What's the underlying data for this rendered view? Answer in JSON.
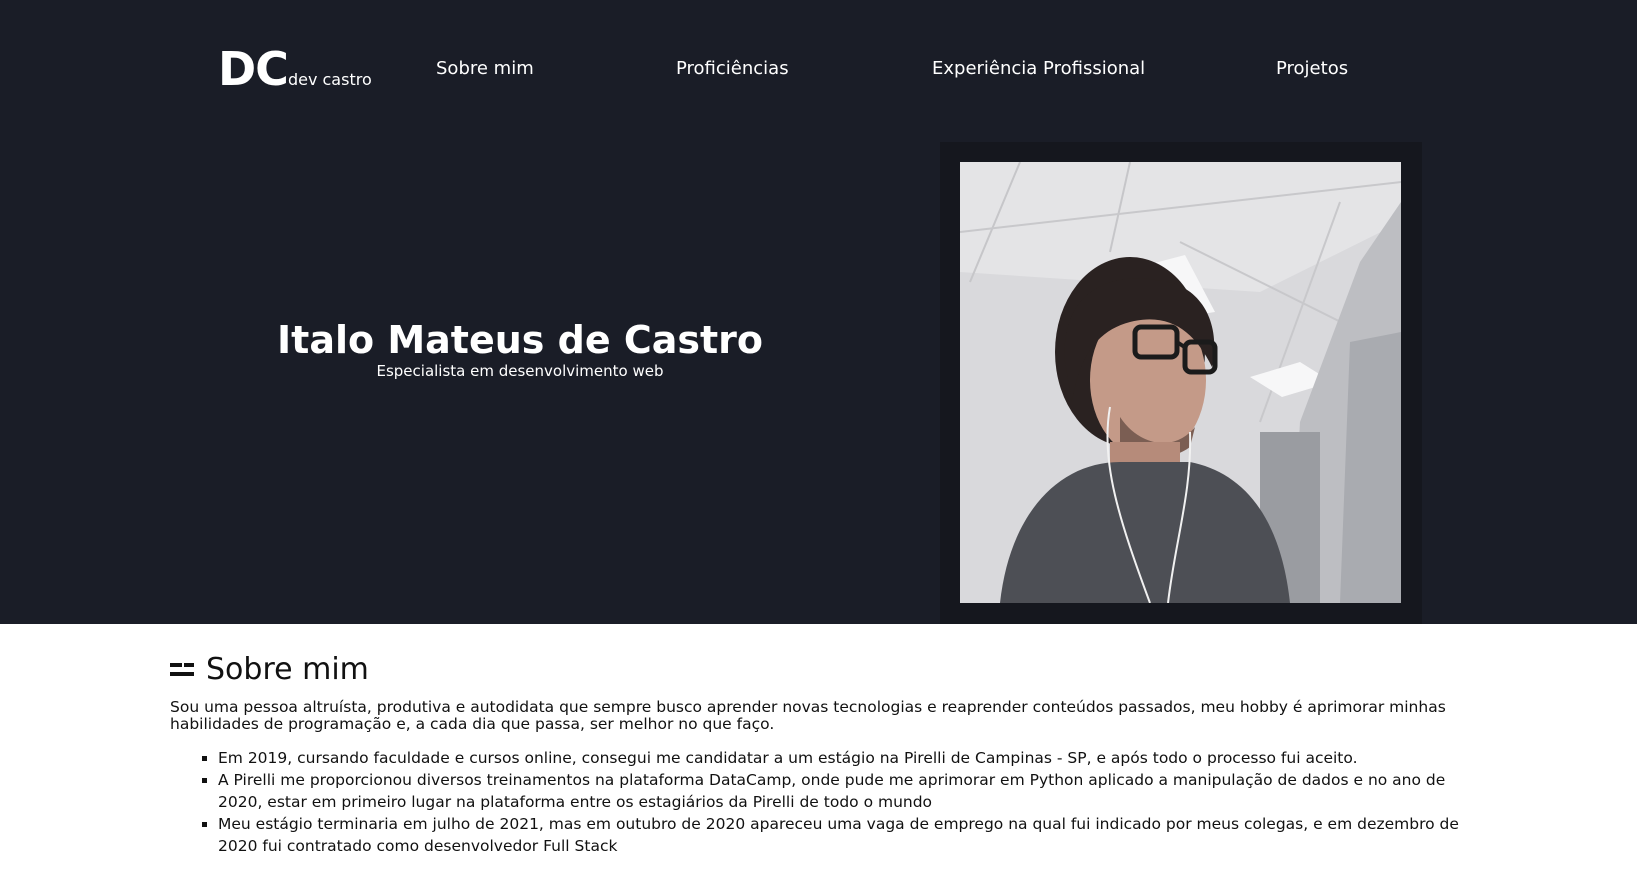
{
  "header": {
    "brand_initials": "DC",
    "brand_name": "dev castro",
    "nav": [
      "Sobre mim",
      "Proficiências",
      "Experiência Profissional",
      "Projetos"
    ]
  },
  "hero": {
    "name": "Italo Mateus de Castro",
    "role": "Especialista em desenvolvimento web"
  },
  "about": {
    "title": "Sobre mim",
    "intro": "Sou uma pessoa altruísta, produtiva e autodidata que sempre busco aprender novas tecnologias e reaprender conteúdos passados, meu hobby é aprimorar minhas habilidades de programação e, a cada dia que passa, ser melhor no que faço.",
    "items": [
      "Em 2019, cursando faculdade e cursos online, consegui me candidatar a um estágio na Pirelli de Campinas - SP, e após todo o processo fui aceito.",
      "A Pirelli me proporcionou diversos treinamentos na plataforma DataCamp, onde pude me aprimorar em Python aplicado a manipulação de dados e no ano de 2020, estar em primeiro lugar na plataforma entre os estagiários da Pirelli de todo o mundo",
      "Meu estágio terminaria em julho de 2021, mas em outubro de 2020 apareceu uma vaga de emprego na qual fui indicado por meus colegas, e em dezembro de 2020 fui contratado como desenvolvedor Full Stack"
    ]
  },
  "colors": {
    "hero_bg": "#1a1d27",
    "text_light": "#ffffff",
    "text_dark": "#111111"
  }
}
